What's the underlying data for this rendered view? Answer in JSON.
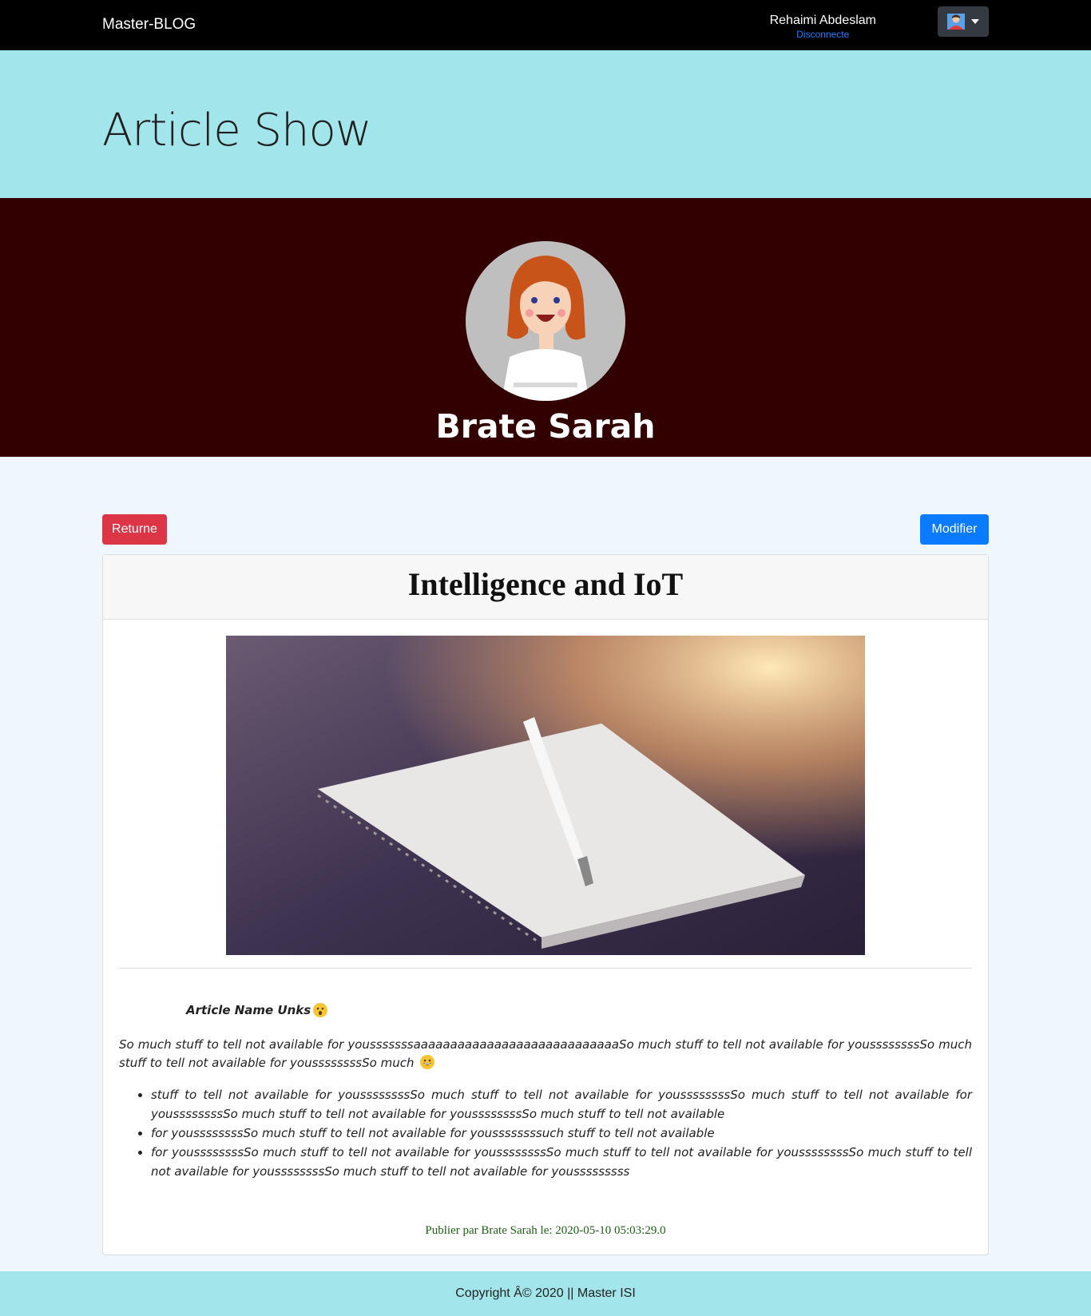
{
  "navbar": {
    "brand": "Master-BLOG",
    "user_name": "Rehaimi Abdeslam",
    "disconnect_label": "Disconnecte"
  },
  "jumbotron": {
    "title": "Article Show"
  },
  "author": {
    "name": "Brate Sarah"
  },
  "actions": {
    "return_label": "Returne",
    "modify_label": "Modifier"
  },
  "article": {
    "title": "Intelligence and IoT",
    "heading": "Article Name Unks",
    "paragraph": "So much stuff to tell not available for yousssssssaaaaaaaaaaaaaaaaaaaaaaaaaaaaSo much stuff to tell not available for youssssssssSo much stuff to tell not available for youssssssssSo much",
    "list": [
      "stuff to tell not available for youssssssssSo much stuff to tell not available for youssssssssSo much stuff to tell not available for youssssssssSo much stuff to tell not available for youssssssssSo much stuff to tell not available",
      "for youssssssssSo much stuff to tell not available for youssssssssuch stuff to tell not available",
      "for youssssssssSo much stuff to tell not available for youssssssssSo much stuff to tell not available for youssssssssSo much stuff to tell not available for youssssssssSo much stuff to tell not available for yousssssssss"
    ],
    "published": "Publier par Brate Sarah le: 2020-05-10 05:03:29.0"
  },
  "footer": {
    "copyright": "Copyright Â© 2020 || Master ISI"
  },
  "colors": {
    "navbar": "#000000",
    "jumbotron": "#a2e5ea",
    "author_band": "#330000",
    "return_button": "#dc3545",
    "modify_button": "#0a7bff",
    "published_text": "#1f5f15"
  },
  "icons": {
    "user_menu": "user-avatar-icon",
    "dropdown": "caret-down-icon",
    "heading_emoji": "surprised-emoji-icon",
    "paragraph_emoji": "grinning-emoji-icon"
  }
}
